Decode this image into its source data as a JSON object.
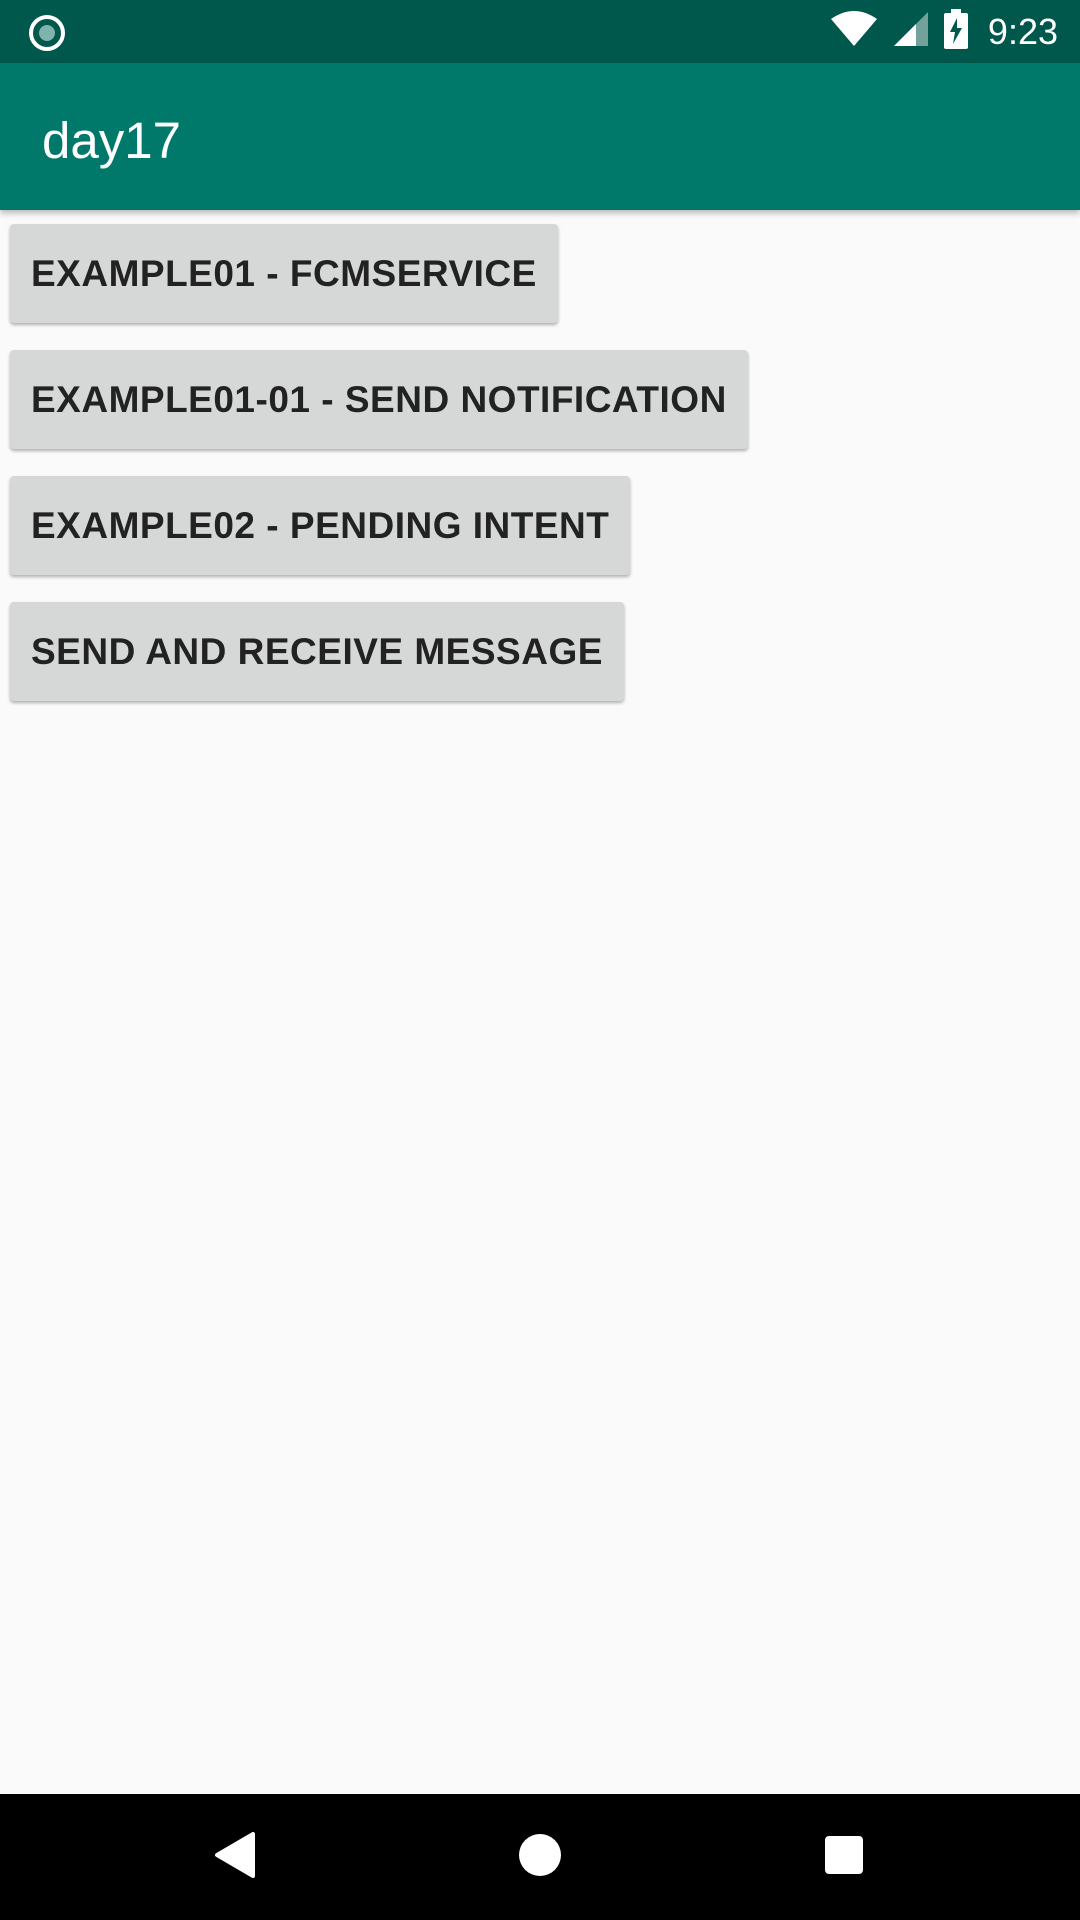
{
  "status_bar": {
    "time": "9:23",
    "icons": [
      "notification-circle-icon",
      "wifi-icon",
      "cell-signal-icon",
      "battery-charging-icon"
    ],
    "background_color": "#00574b"
  },
  "app_bar": {
    "title": "day17",
    "background_color": "#00796b"
  },
  "buttons": [
    {
      "label": "EXAMPLE01 - FCMSERVICE"
    },
    {
      "label": "EXAMPLE01-01 - SEND NOTIFICATION"
    },
    {
      "label": "EXAMPLE02 - PENDING INTENT"
    },
    {
      "label": "SEND AND RECEIVE MESSAGE"
    }
  ],
  "nav_bar": {
    "icons": [
      "back-icon",
      "home-icon",
      "recents-icon"
    ]
  }
}
